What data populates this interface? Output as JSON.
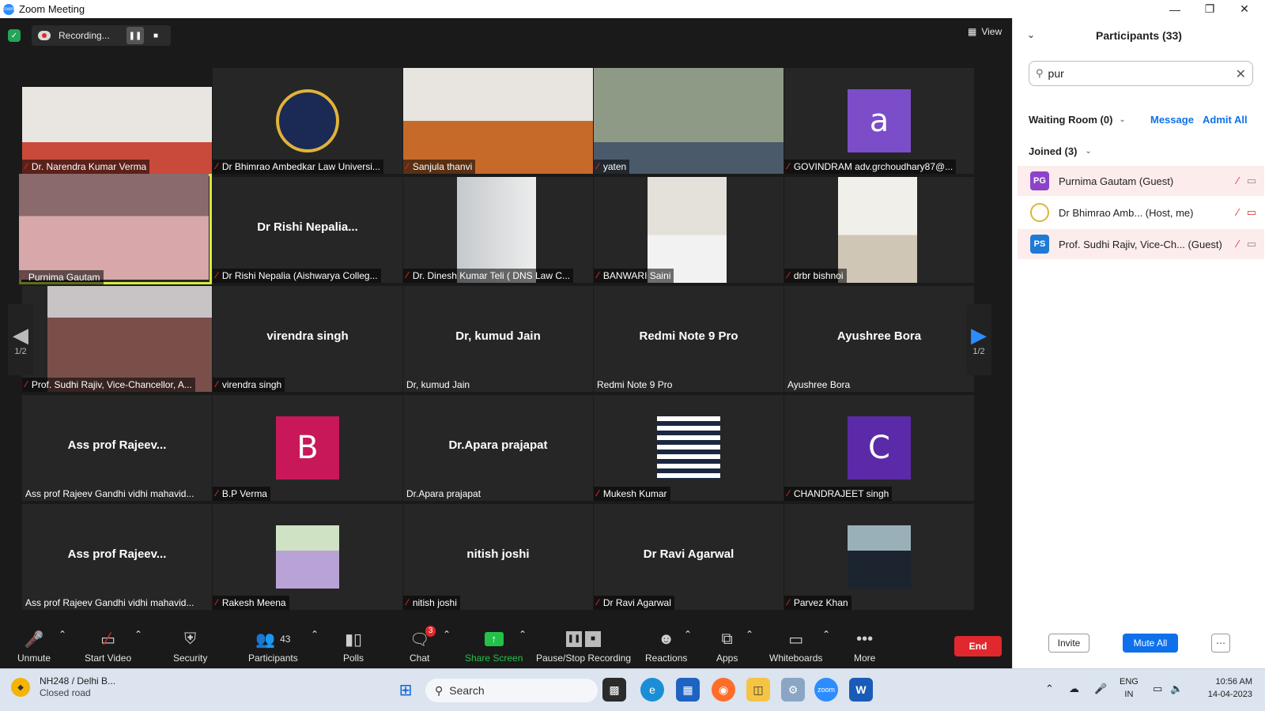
{
  "window": {
    "title": "Zoom Meeting"
  },
  "recording": {
    "status": "Recording..."
  },
  "view_label": "View",
  "tiles": [
    {
      "label": "Dr. Narendra Kumar Verma",
      "muted": true,
      "type": "video"
    },
    {
      "label": "Dr Bhimrao Ambedkar Law Universi...",
      "muted": true,
      "type": "logo"
    },
    {
      "label": "Sanjula thanvi",
      "muted": true,
      "type": "video"
    },
    {
      "label": "yaten",
      "muted": true,
      "type": "video"
    },
    {
      "label": "GOVINDRAM adv.grchoudhary87@...",
      "muted": true,
      "type": "avatar",
      "letter": "a",
      "color": "#7b4dc9"
    },
    {
      "label": "Purnima Gautam",
      "muted": true,
      "type": "video",
      "active": true
    },
    {
      "label": "Dr Rishi Nepalia (Aishwarya Colleg...",
      "muted": true,
      "type": "name",
      "center": "Dr Rishi  Nepalia..."
    },
    {
      "label": "Dr. Dinesh Kumar Teli ( DNS Law C...",
      "muted": true,
      "type": "video"
    },
    {
      "label": "BANWARI Saini",
      "muted": true,
      "type": "video"
    },
    {
      "label": "drbr bishnoi",
      "muted": true,
      "type": "video"
    },
    {
      "label": "Prof. Sudhi Rajiv, Vice-Chancellor, A...",
      "muted": true,
      "type": "video"
    },
    {
      "label": "virendra singh",
      "muted": true,
      "type": "name",
      "center": "virendra singh"
    },
    {
      "label": "Dr, kumud Jain",
      "muted": false,
      "type": "name",
      "center": "Dr, kumud Jain"
    },
    {
      "label": "Redmi Note 9 Pro",
      "muted": false,
      "type": "name",
      "center": "Redmi Note 9 Pro"
    },
    {
      "label": "Ayushree Bora",
      "muted": false,
      "type": "name",
      "center": "Ayushree Bora"
    },
    {
      "label": "Ass prof Rajeev Gandhi vidhi mahavid...",
      "muted": false,
      "type": "name",
      "center": "Ass prof Rajeev..."
    },
    {
      "label": "B.P Verma",
      "muted": true,
      "type": "avatar",
      "letter": "B",
      "color": "#c8185a"
    },
    {
      "label": "Dr.Apara prajapat",
      "muted": false,
      "type": "name",
      "center": "Dr.Apara prajapat"
    },
    {
      "label": "Mukesh Kumar",
      "muted": true,
      "type": "video"
    },
    {
      "label": "CHANDRAJEET singh",
      "muted": true,
      "type": "avatar",
      "letter": "C",
      "color": "#5b2aa8"
    },
    {
      "label": "Ass prof Rajeev Gandhi vidhi mahavid...",
      "muted": false,
      "type": "name",
      "center": "Ass prof Rajeev..."
    },
    {
      "label": "Rakesh Meena",
      "muted": true,
      "type": "video"
    },
    {
      "label": "nitish joshi",
      "muted": true,
      "type": "name",
      "center": "nitish joshi"
    },
    {
      "label": "Dr Ravi Agarwal",
      "muted": true,
      "type": "name",
      "center": "Dr Ravi Agarwal"
    },
    {
      "label": "Parvez Khan",
      "muted": true,
      "type": "video"
    }
  ],
  "pager": {
    "left": "1/2",
    "right": "1/2"
  },
  "toolbar": {
    "unmute": "Unmute",
    "start_video": "Start Video",
    "security": "Security",
    "participants": "Participants",
    "participants_count": "43",
    "polls": "Polls",
    "chat": "Chat",
    "chat_badge": "3",
    "share_screen": "Share Screen",
    "pause_stop": "Pause/Stop Recording",
    "reactions": "Reactions",
    "apps": "Apps",
    "whiteboards": "Whiteboards",
    "more": "More",
    "end": "End"
  },
  "panel": {
    "title": "Participants (33)",
    "search_value": "pur",
    "waiting_room": "Waiting Room (0)",
    "message": "Message",
    "admit_all": "Admit All",
    "joined": "Joined (3)",
    "participants": [
      {
        "initials": "PG",
        "name": "Purnima Gautam (Guest)",
        "color": "#8b44c9",
        "highlight": true
      },
      {
        "initials": "",
        "name": "Dr Bhimrao Amb...   (Host, me)",
        "color": "#ffffff",
        "highlight": false
      },
      {
        "initials": "PS",
        "name": "Prof. Sudhi Rajiv, Vice-Ch... (Guest)",
        "color": "#1f7ad6",
        "highlight": true
      }
    ],
    "invite": "Invite",
    "mute_all": "Mute All"
  },
  "taskbar": {
    "weather_title": "NH248 / Delhi B...",
    "weather_sub": "Closed road",
    "search": "Search",
    "lang_top": "ENG",
    "lang_bottom": "IN",
    "time": "10:56 AM",
    "date": "14-04-2023"
  }
}
